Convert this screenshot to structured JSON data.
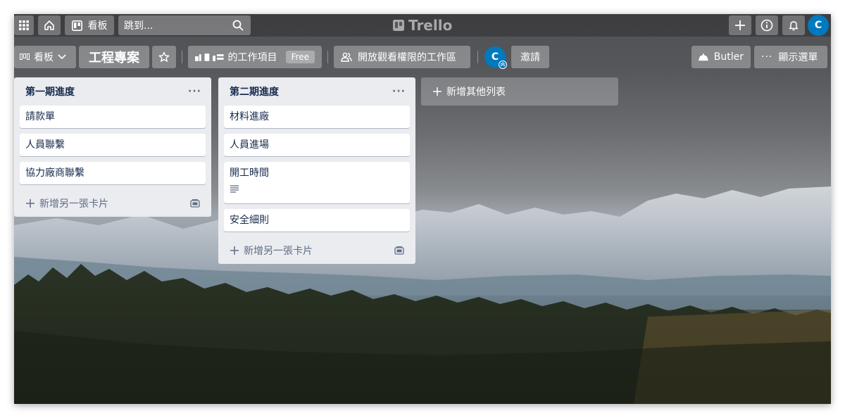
{
  "header": {
    "board_label": "看板",
    "search_placeholder": "跳到...",
    "logo_text": "Trello",
    "avatar_initial": "C"
  },
  "board": {
    "view_label": "看板",
    "title": "工程專案",
    "workspace_name": "的工作項目",
    "workspace_badge": "Free",
    "visibility_label": "開放觀看權限的工作區",
    "member_initial": "C",
    "invite_label": "邀請",
    "butler_label": "Butler",
    "menu_label": "顯示選單"
  },
  "lists": [
    {
      "title": "第一期進度",
      "cards": [
        "請款單",
        "人員聯繫",
        "協力廠商聯繫"
      ],
      "add_card_label": "新增另一張卡片"
    },
    {
      "title": "第二期進度",
      "cards": [
        "材料進廠",
        "人員進場",
        "開工時間",
        "安全細則"
      ],
      "add_card_label": "新增另一張卡片"
    }
  ],
  "add_list_label": "新增其他列表",
  "colors": {
    "accent": "#0079bf",
    "list_bg": "#ebecf0",
    "text": "#172b4d"
  }
}
